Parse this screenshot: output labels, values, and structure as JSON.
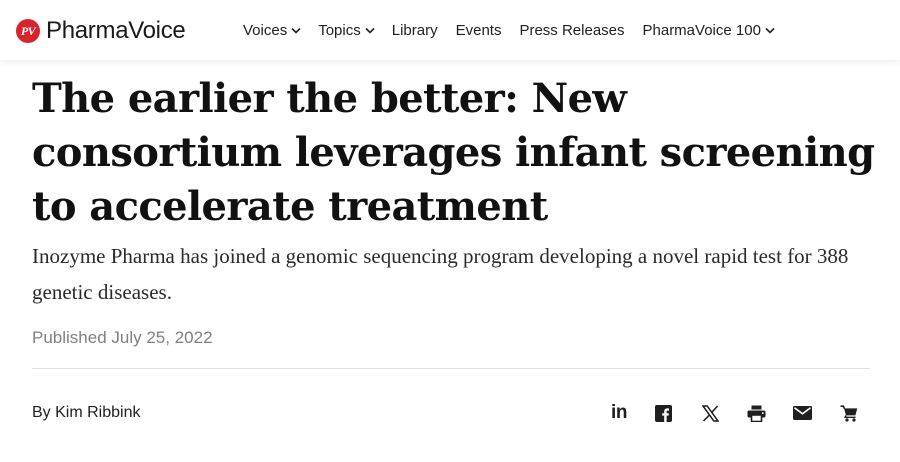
{
  "brand": {
    "logo_mark": "PV",
    "name": "PharmaVoice",
    "accent_color": "#d7232b"
  },
  "nav": {
    "items": [
      {
        "label": "Voices",
        "has_dropdown": true
      },
      {
        "label": "Topics",
        "has_dropdown": true
      },
      {
        "label": "Library",
        "has_dropdown": false
      },
      {
        "label": "Events",
        "has_dropdown": false
      },
      {
        "label": "Press Releases",
        "has_dropdown": false
      },
      {
        "label": "PharmaVoice 100",
        "has_dropdown": true
      }
    ]
  },
  "article": {
    "headline": "The earlier the better: New consortium leverages infant screening to accelerate treatment",
    "dek": "Inozyme Pharma has joined a genomic sequencing program developing a novel rapid test for 388 genetic diseases.",
    "published": "Published July 25, 2022",
    "byline": "By Kim Ribbink"
  },
  "share": {
    "icons": [
      "linkedin-icon",
      "facebook-icon",
      "x-icon",
      "print-icon",
      "email-icon",
      "cart-icon"
    ],
    "linkedin_text": "in"
  }
}
